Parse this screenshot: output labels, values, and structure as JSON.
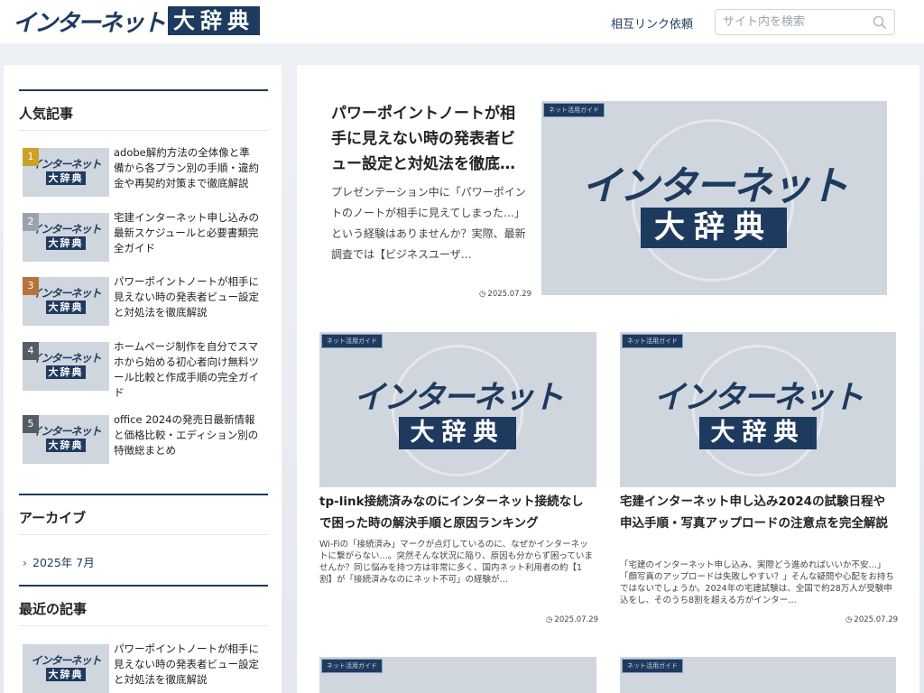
{
  "header": {
    "logo_kana": "インターネット",
    "logo_kanji": "大辞典",
    "link_label": "相互リンク依頼",
    "search_placeholder": "サイト内を検索"
  },
  "sidebar": {
    "popular_title": "人気記事",
    "popular": [
      {
        "rank": "1",
        "title": "adobe解約方法の全体像と準備から各プラン別の手順・違約金や再契約対策まで徹底解説",
        "color": "#c9a227"
      },
      {
        "rank": "2",
        "title": "宅建インターネット申し込みの最新スケジュールと必要書類完全ガイド",
        "color": "#9aa3ad"
      },
      {
        "rank": "3",
        "title": "パワーポイントノートが相手に見えない時の発表者ビュー設定と対処法を徹底解説",
        "color": "#b8733a"
      },
      {
        "rank": "4",
        "title": "ホームページ制作を自分でスマホから始める初心者向け無料ツール比較と作成手順の完全ガイド",
        "color": "#555c64"
      },
      {
        "rank": "5",
        "title": "office 2024の発売日最新情報と価格比較・エディション別の特徴総まとめ",
        "color": "#555c64"
      }
    ],
    "archive_title": "アーカイブ",
    "archive_link": "2025年 7月",
    "recent_title": "最近の記事",
    "recent": [
      {
        "title": "パワーポイントノートが相手に見えない時の発表者ビュー設定と対処法を徹底解説"
      }
    ],
    "thumb_kana": "インターネット",
    "thumb_kanji": "大辞典"
  },
  "main": {
    "category": "ネット活用ガイド",
    "eyecatch_kana": "インターネット",
    "eyecatch_kanji": "大辞典",
    "hero": {
      "title": "パワーポイントノートが相手に見えない時の発表者ビュー設定と対処法を徹底…",
      "excerpt": "プレゼンテーション中に「パワーポイントのノートが相手に見えてしまった…」という経験はありませんか？実際、最新調査では【ビジネスユーザ…",
      "date": "2025.07.29"
    },
    "cards": [
      {
        "title": "tp-link接続済みなのにインターネット接続なしで困った時の解決手順と原因ランキング",
        "excerpt": "Wi-Fiの「接続済み」マークが点灯しているのに、なぜかインターネットに繋がらない…。突然そんな状況に陥り、原因も分からず困っていませんか？同じ悩みを持つ方は非常に多く、国内ネット利用者の約【1割】が「接続済みなのにネット不可」の経験が…",
        "date": "2025.07.29"
      },
      {
        "title": "宅建インターネット申し込み2024の試験日程や申込手順・写真アップロードの注意点を完全解説",
        "excerpt": "「宅建のインターネット申し込み、実際どう進めればいいか不安…」「顔写真のアップロードは失敗しやすい？」そんな疑問や心配をお持ちではないでしょうか。2024年の宅建試験は、全国で約28万人が受験申込をし、そのうち8割を超える方がインター…",
        "date": "2025.07.29"
      }
    ]
  }
}
